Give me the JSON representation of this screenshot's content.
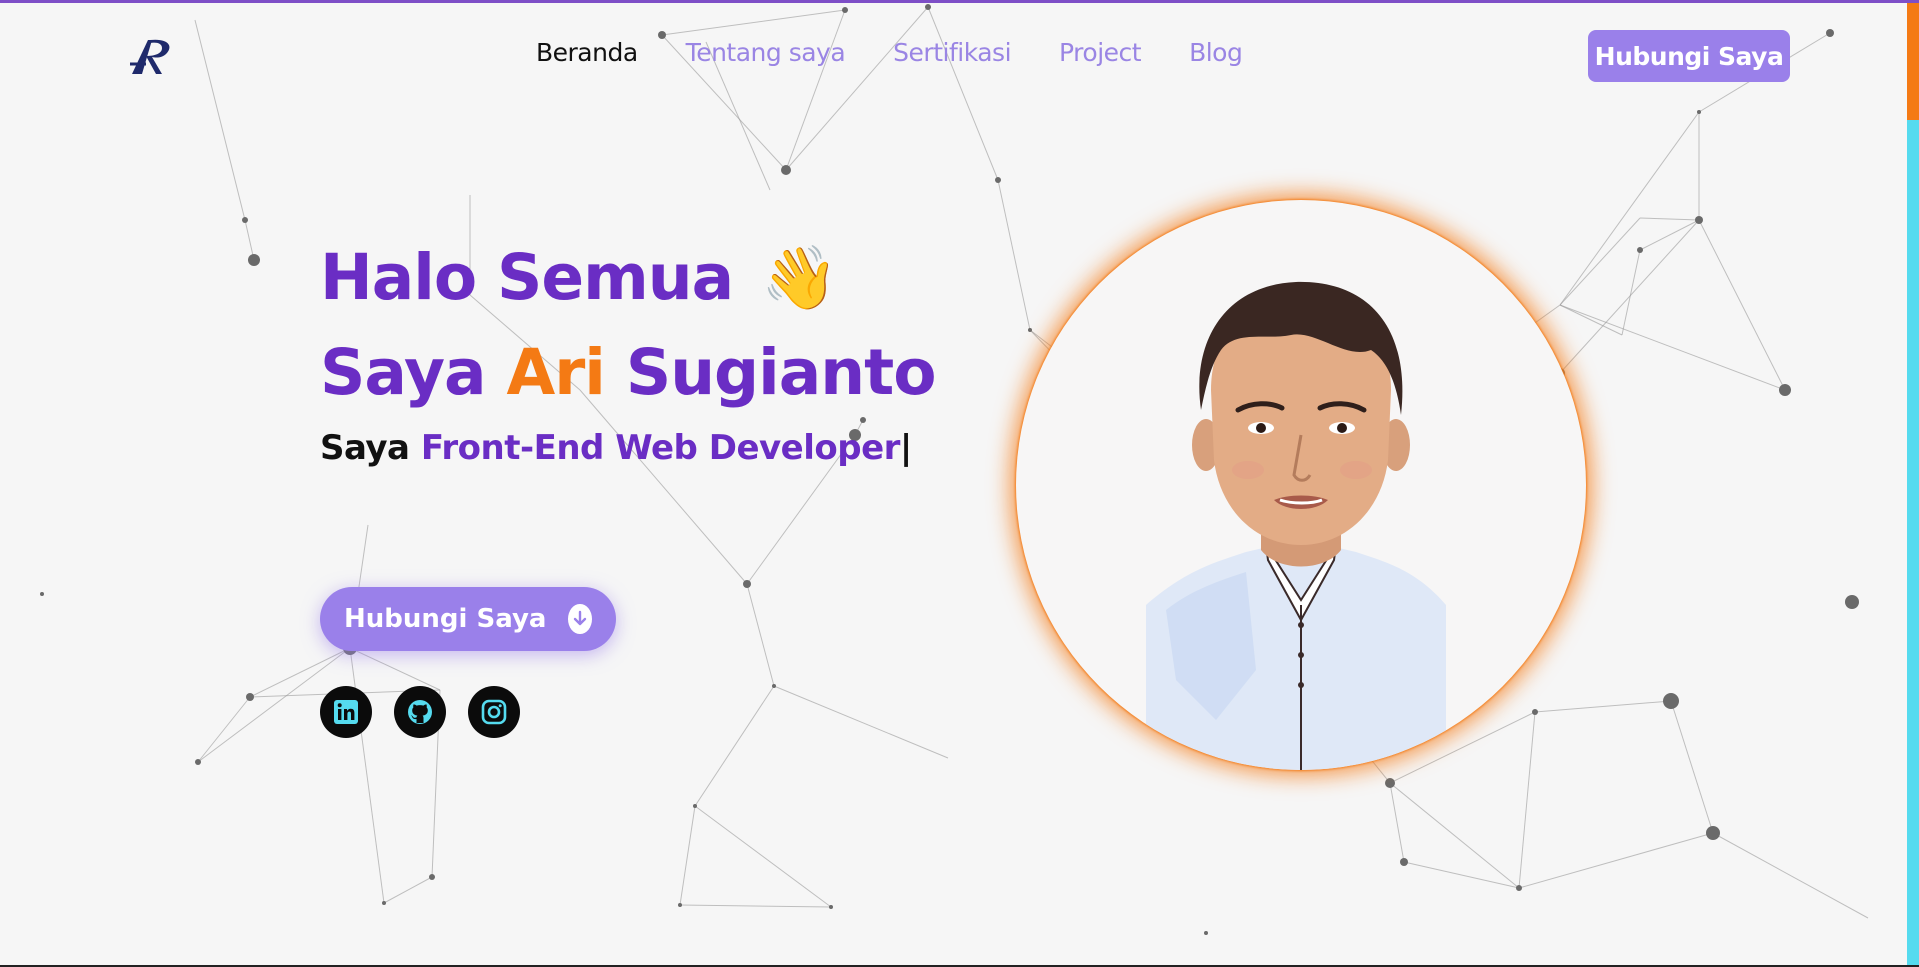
{
  "brand": {
    "logo_text": "AR"
  },
  "nav": {
    "items": [
      {
        "label": "Beranda",
        "active": true
      },
      {
        "label": "Tentang saya",
        "active": false
      },
      {
        "label": "Sertifikasi",
        "active": false
      },
      {
        "label": "Project",
        "active": false
      },
      {
        "label": "Blog",
        "active": false
      }
    ],
    "cta_label": "Hubungi Saya"
  },
  "hero": {
    "greeting": "Halo Semua",
    "greeting_emoji": "👋",
    "intro_prefix": "Saya",
    "first_name": "Ari",
    "last_name": "Sugianto",
    "role_prefix": "Saya",
    "role": "Front-End Web Developer",
    "typing_cursor": "|",
    "cta_label": "Hubungi Saya",
    "cta_icon": "arrow-down-circle-icon"
  },
  "socials": [
    {
      "name": "LinkedIn",
      "icon": "linkedin-icon"
    },
    {
      "name": "GitHub",
      "icon": "github-icon"
    },
    {
      "name": "Instagram",
      "icon": "instagram-icon"
    }
  ],
  "colors": {
    "primary_purple": "#6a2dc4",
    "accent_orange": "#f47a14",
    "nav_link": "#9a85e4",
    "button_bg": "#9a80ea",
    "social_icon": "#55dbef",
    "background": "#f6f6f6"
  }
}
